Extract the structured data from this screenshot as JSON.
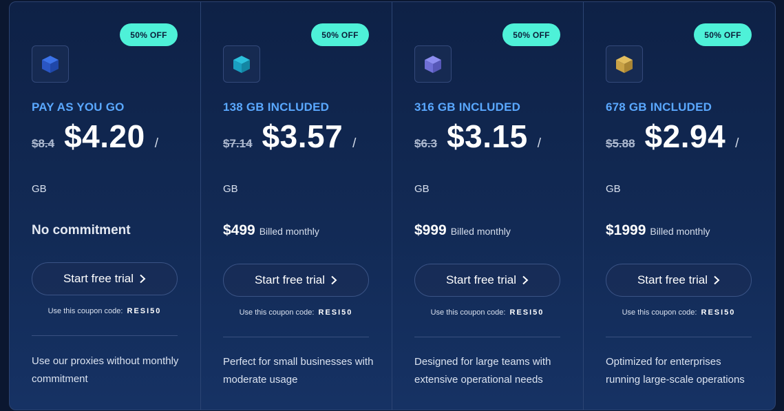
{
  "plans": [
    {
      "badge": "50% OFF",
      "icon": "cube-icon",
      "icon_color": "#2f5fd0",
      "tier": "PAY AS YOU GO",
      "old_price": "$8.4",
      "price": "$4.20",
      "slash": "/",
      "unit": "GB",
      "commitment": "No commitment",
      "billing_amount": "",
      "billing_period": "",
      "cta": "Start free trial",
      "coupon_text": "Use this coupon code:",
      "coupon_code": "RESI50",
      "description": "Use our proxies without monthly commitment"
    },
    {
      "badge": "50% OFF",
      "icon": "cube-icon",
      "icon_color": "#1a9fc0",
      "tier": "138 GB INCLUDED",
      "old_price": "$7.14",
      "price": "$3.57",
      "slash": "/",
      "unit": "GB",
      "commitment": "",
      "billing_amount": "$499",
      "billing_period": "Billed monthly",
      "cta": "Start free trial",
      "coupon_text": "Use this coupon code:",
      "coupon_code": "RESI50",
      "description": "Perfect for small businesses with moderate usage"
    },
    {
      "badge": "50% OFF",
      "icon": "cube-icon",
      "icon_color": "#6f6fd6",
      "tier": "316 GB INCLUDED",
      "old_price": "$6.3",
      "price": "$3.15",
      "slash": "/",
      "unit": "GB",
      "commitment": "",
      "billing_amount": "$999",
      "billing_period": "Billed monthly",
      "cta": "Start free trial",
      "coupon_text": "Use this coupon code:",
      "coupon_code": "RESI50",
      "description": "Designed for large teams with extensive operational needs"
    },
    {
      "badge": "50% OFF",
      "icon": "cube-icon",
      "icon_color": "#c9a246",
      "tier": "678 GB INCLUDED",
      "old_price": "$5.88",
      "price": "$2.94",
      "slash": "/",
      "unit": "GB",
      "commitment": "",
      "billing_amount": "$1999",
      "billing_period": "Billed monthly",
      "cta": "Start free trial",
      "coupon_text": "Use this coupon code:",
      "coupon_code": "RESI50",
      "description": "Optimized for enterprises running large-scale operations"
    }
  ],
  "colors": {
    "badge_bg": "#4ef1d8",
    "tier_text": "#5aa8ff",
    "background": "#0e2146"
  }
}
